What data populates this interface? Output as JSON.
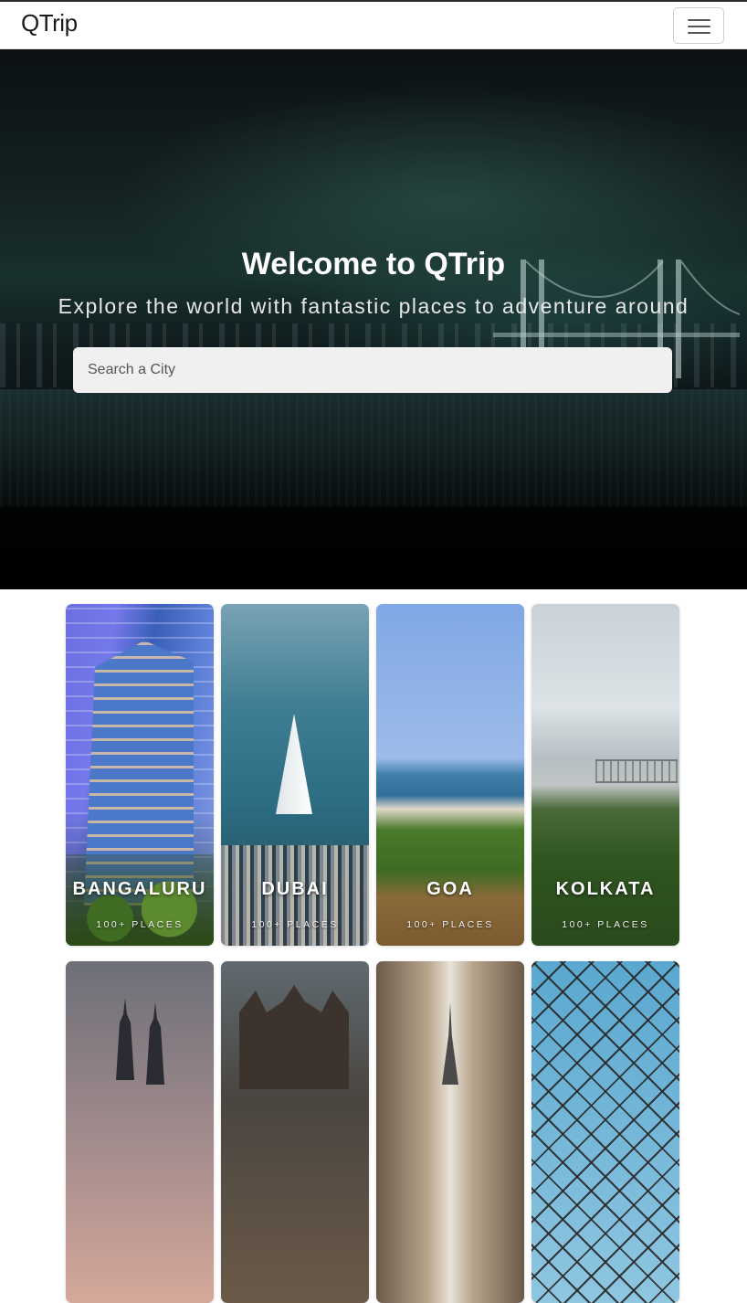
{
  "nav": {
    "brand": "QTrip"
  },
  "hero": {
    "title": "Welcome to QTrip",
    "subtitle": "Explore the world with fantastic places to adventure around",
    "search_placeholder": "Search a City"
  },
  "cities": [
    {
      "name": "BANGALURU",
      "count": "100+ PLACES"
    },
    {
      "name": "DUBAI",
      "count": "100+ PLACES"
    },
    {
      "name": "GOA",
      "count": "100+ PLACES"
    },
    {
      "name": "KOLKATA",
      "count": "100+ PLACES"
    }
  ]
}
